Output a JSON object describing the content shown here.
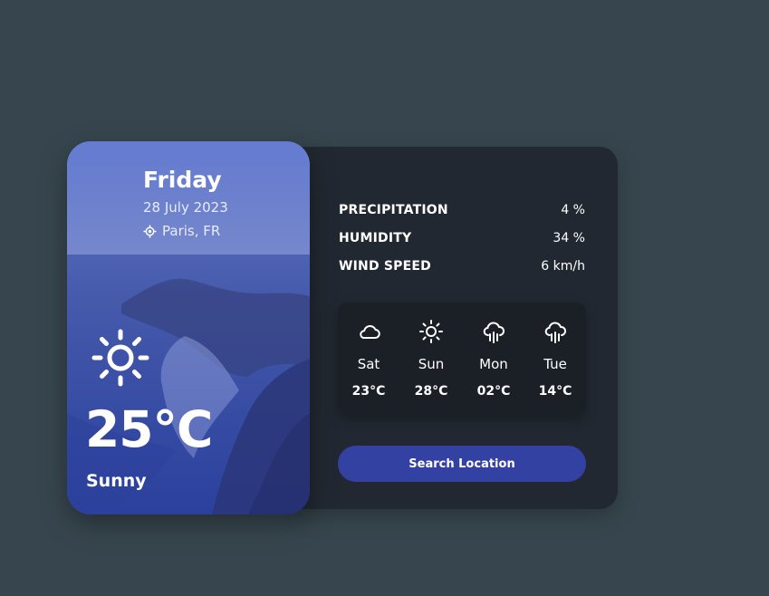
{
  "card": {
    "day": "Friday",
    "date": "28 July 2023",
    "location": "Paris, FR",
    "location_icon": "location-target-icon",
    "current_icon": "sun-icon",
    "temperature": "25°C",
    "condition": "Sunny"
  },
  "stats": [
    {
      "label": "PRECIPITATION",
      "value": "4 %"
    },
    {
      "label": "HUMIDITY",
      "value": "34 %"
    },
    {
      "label": "WIND SPEED",
      "value": "6 km/h"
    }
  ],
  "forecast": [
    {
      "day": "Sat",
      "temp": "23°C",
      "icon": "cloud-icon"
    },
    {
      "day": "Sun",
      "temp": "28°C",
      "icon": "sun-icon"
    },
    {
      "day": "Mon",
      "temp": "02°C",
      "icon": "cloud-rain-icon"
    },
    {
      "day": "Tue",
      "temp": "14°C",
      "icon": "cloud-rain-icon"
    }
  ],
  "search_button": "Search Location",
  "colors": {
    "page_background": "#37464e",
    "panel_background": "#222831",
    "forecast_background": "#1b2027",
    "button": "#3342a2"
  }
}
